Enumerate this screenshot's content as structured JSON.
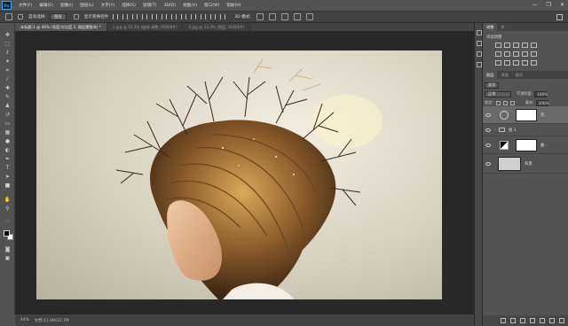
{
  "app": {
    "logo": "Ps"
  },
  "menu": [
    "文件(F)",
    "编辑(E)",
    "图像(I)",
    "图层(L)",
    "文字(Y)",
    "选择(S)",
    "滤镜(T)",
    "3D(D)",
    "视图(V)",
    "窗口(W)",
    "帮助(H)"
  ],
  "window_controls": {
    "minimize": "—",
    "maximize": "❐",
    "close": "✕"
  },
  "options": {
    "auto_select_label": "自动选择:",
    "auto_select_value": "图层",
    "show_transform": "显示变换控件",
    "mode_3d": "3D 模式:"
  },
  "tabs": [
    {
      "label": "未标题-1 @ 44% (亮度/对比度 2, 图层蒙版/8) *",
      "active": true
    },
    {
      "label": "1.jpg @ 53.2% (曲线 调整, RGB/8#)",
      "active": false
    },
    {
      "label": "2.jpg @ 33.3% (图层, RGB/8#)",
      "active": false
    }
  ],
  "status": {
    "zoom": "44%",
    "doc_info": "文档:11.4M/31.7M"
  },
  "panels": {
    "top_tabs": [
      "调整",
      "库"
    ],
    "adjust_title": "添加调整",
    "layer_tabs": [
      "图层",
      "通道",
      "路径"
    ],
    "kind_label": "类型",
    "blend_mode": "正常",
    "opacity_label": "不透明度:",
    "opacity_value": "100%",
    "lock_label": "锁定:",
    "fill_label": "填充:",
    "fill_value": "100%",
    "layers": [
      {
        "name": "亮...",
        "type": "adjustment",
        "selected": true
      },
      {
        "name": "组 1",
        "type": "group",
        "selected": false
      },
      {
        "name": "曲...",
        "type": "adjustment",
        "selected": false
      },
      {
        "name": "背景",
        "type": "background",
        "selected": false
      }
    ]
  },
  "colors": {
    "foreground": "#000000",
    "background": "#ffffff",
    "accent": "#31a8ff",
    "canvas_bg": "#282828",
    "ui_bg": "#535353"
  },
  "icons": [
    "move-icon",
    "marquee-icon",
    "lasso-icon",
    "magic-wand-icon",
    "crop-icon",
    "eyedropper-icon",
    "healing-icon",
    "brush-icon",
    "clone-stamp-icon",
    "history-brush-icon",
    "eraser-icon",
    "gradient-icon",
    "blur-icon",
    "dodge-icon",
    "pen-icon",
    "type-icon",
    "path-select-icon",
    "rectangle-icon",
    "hand-icon",
    "zoom-icon"
  ]
}
